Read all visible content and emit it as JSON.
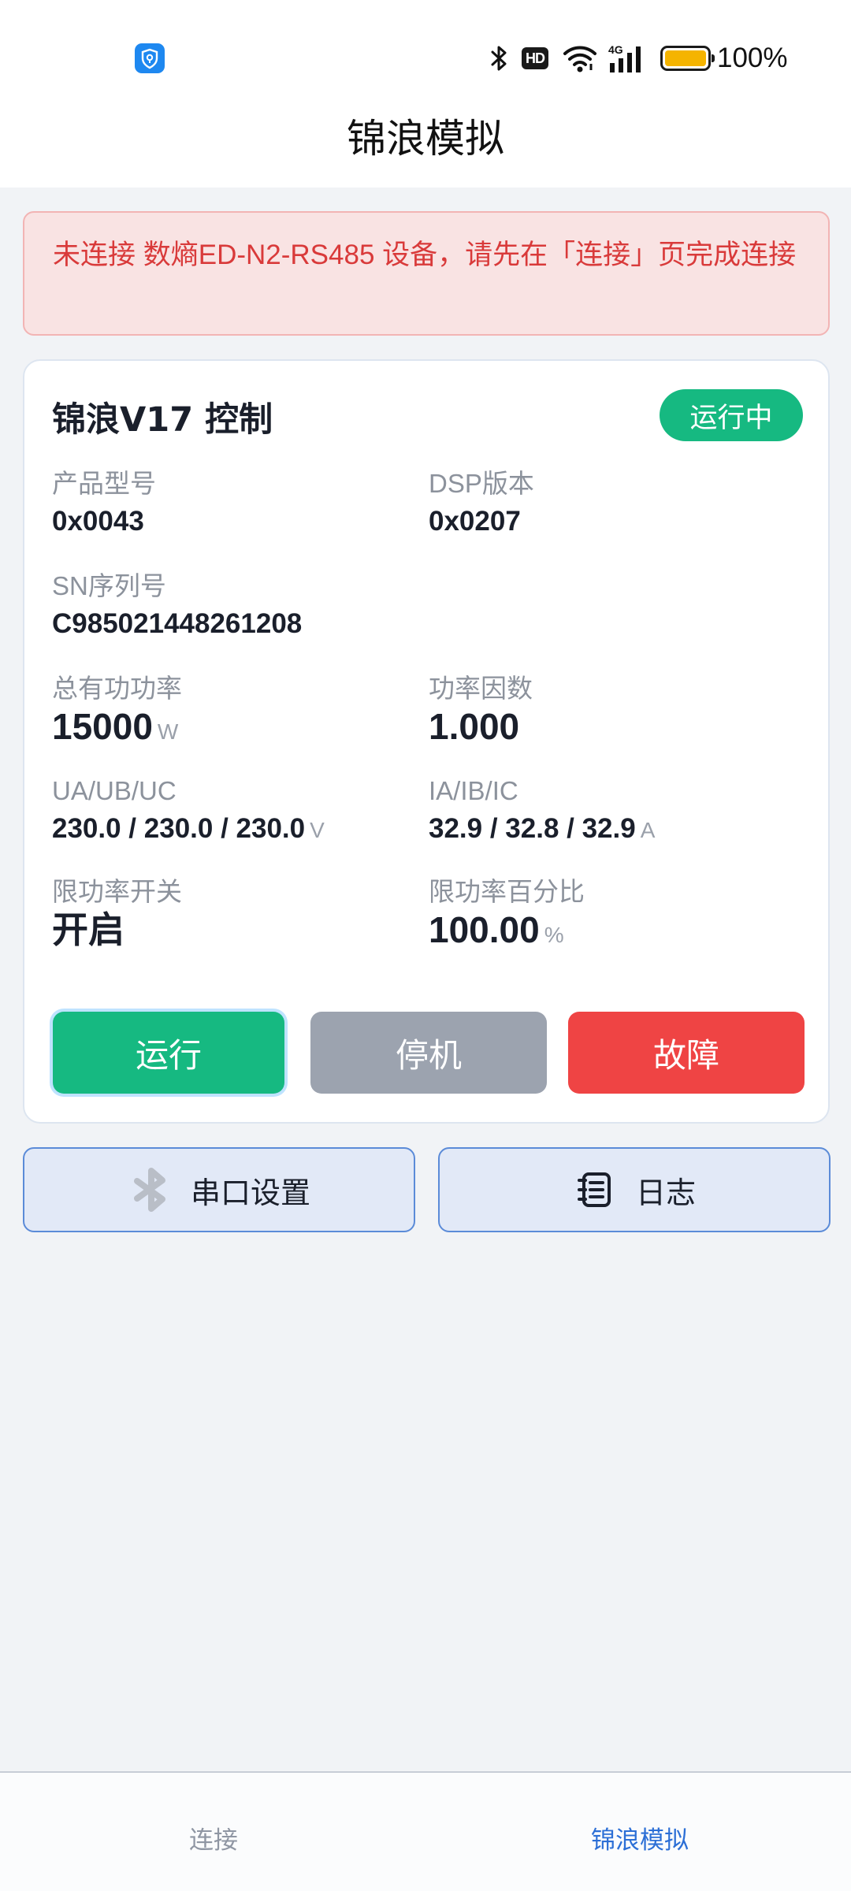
{
  "status_bar": {
    "battery_text": "100%",
    "hd_label": "HD",
    "network_label": "4G",
    "battery_level": 1.0
  },
  "header": {
    "title": "锦浪模拟"
  },
  "alert": {
    "text": "未连接 数熵ED-N2-RS485 设备，请先在「连接」页完成连接"
  },
  "card": {
    "title": "锦浪V17 控制",
    "status_badge": "运行中",
    "product_model": {
      "label": "产品型号",
      "value": "0x0043"
    },
    "dsp_version": {
      "label": "DSP版本",
      "value": "0x0207"
    },
    "sn": {
      "label": "SN序列号",
      "value": "C985021448261208"
    },
    "total_power": {
      "label": "总有功功率",
      "value": "15000",
      "unit": "W"
    },
    "power_factor": {
      "label": "功率因数",
      "value": "1.000"
    },
    "voltage": {
      "label": "UA/UB/UC",
      "value": "230.0 / 230.0 / 230.0",
      "unit": "V"
    },
    "current": {
      "label": "IA/IB/IC",
      "value": "32.9 / 32.8 / 32.9",
      "unit": "A"
    },
    "limit_switch": {
      "label": "限功率开关",
      "value": "开启"
    },
    "limit_percent": {
      "label": "限功率百分比",
      "value": "100.00",
      "unit": "%"
    },
    "buttons": {
      "run": "运行",
      "stop": "停机",
      "fault": "故障"
    }
  },
  "actions": {
    "serial_settings": "串口设置",
    "log": "日志"
  },
  "bottom_nav": {
    "connect": "连接",
    "simulate": "锦浪模拟"
  },
  "colors": {
    "accent_green": "#16b981",
    "stop_gray": "#9ca3af",
    "fault_red": "#ef4444",
    "alert_text": "#d93a3a",
    "nav_active": "#2c6fd6"
  }
}
